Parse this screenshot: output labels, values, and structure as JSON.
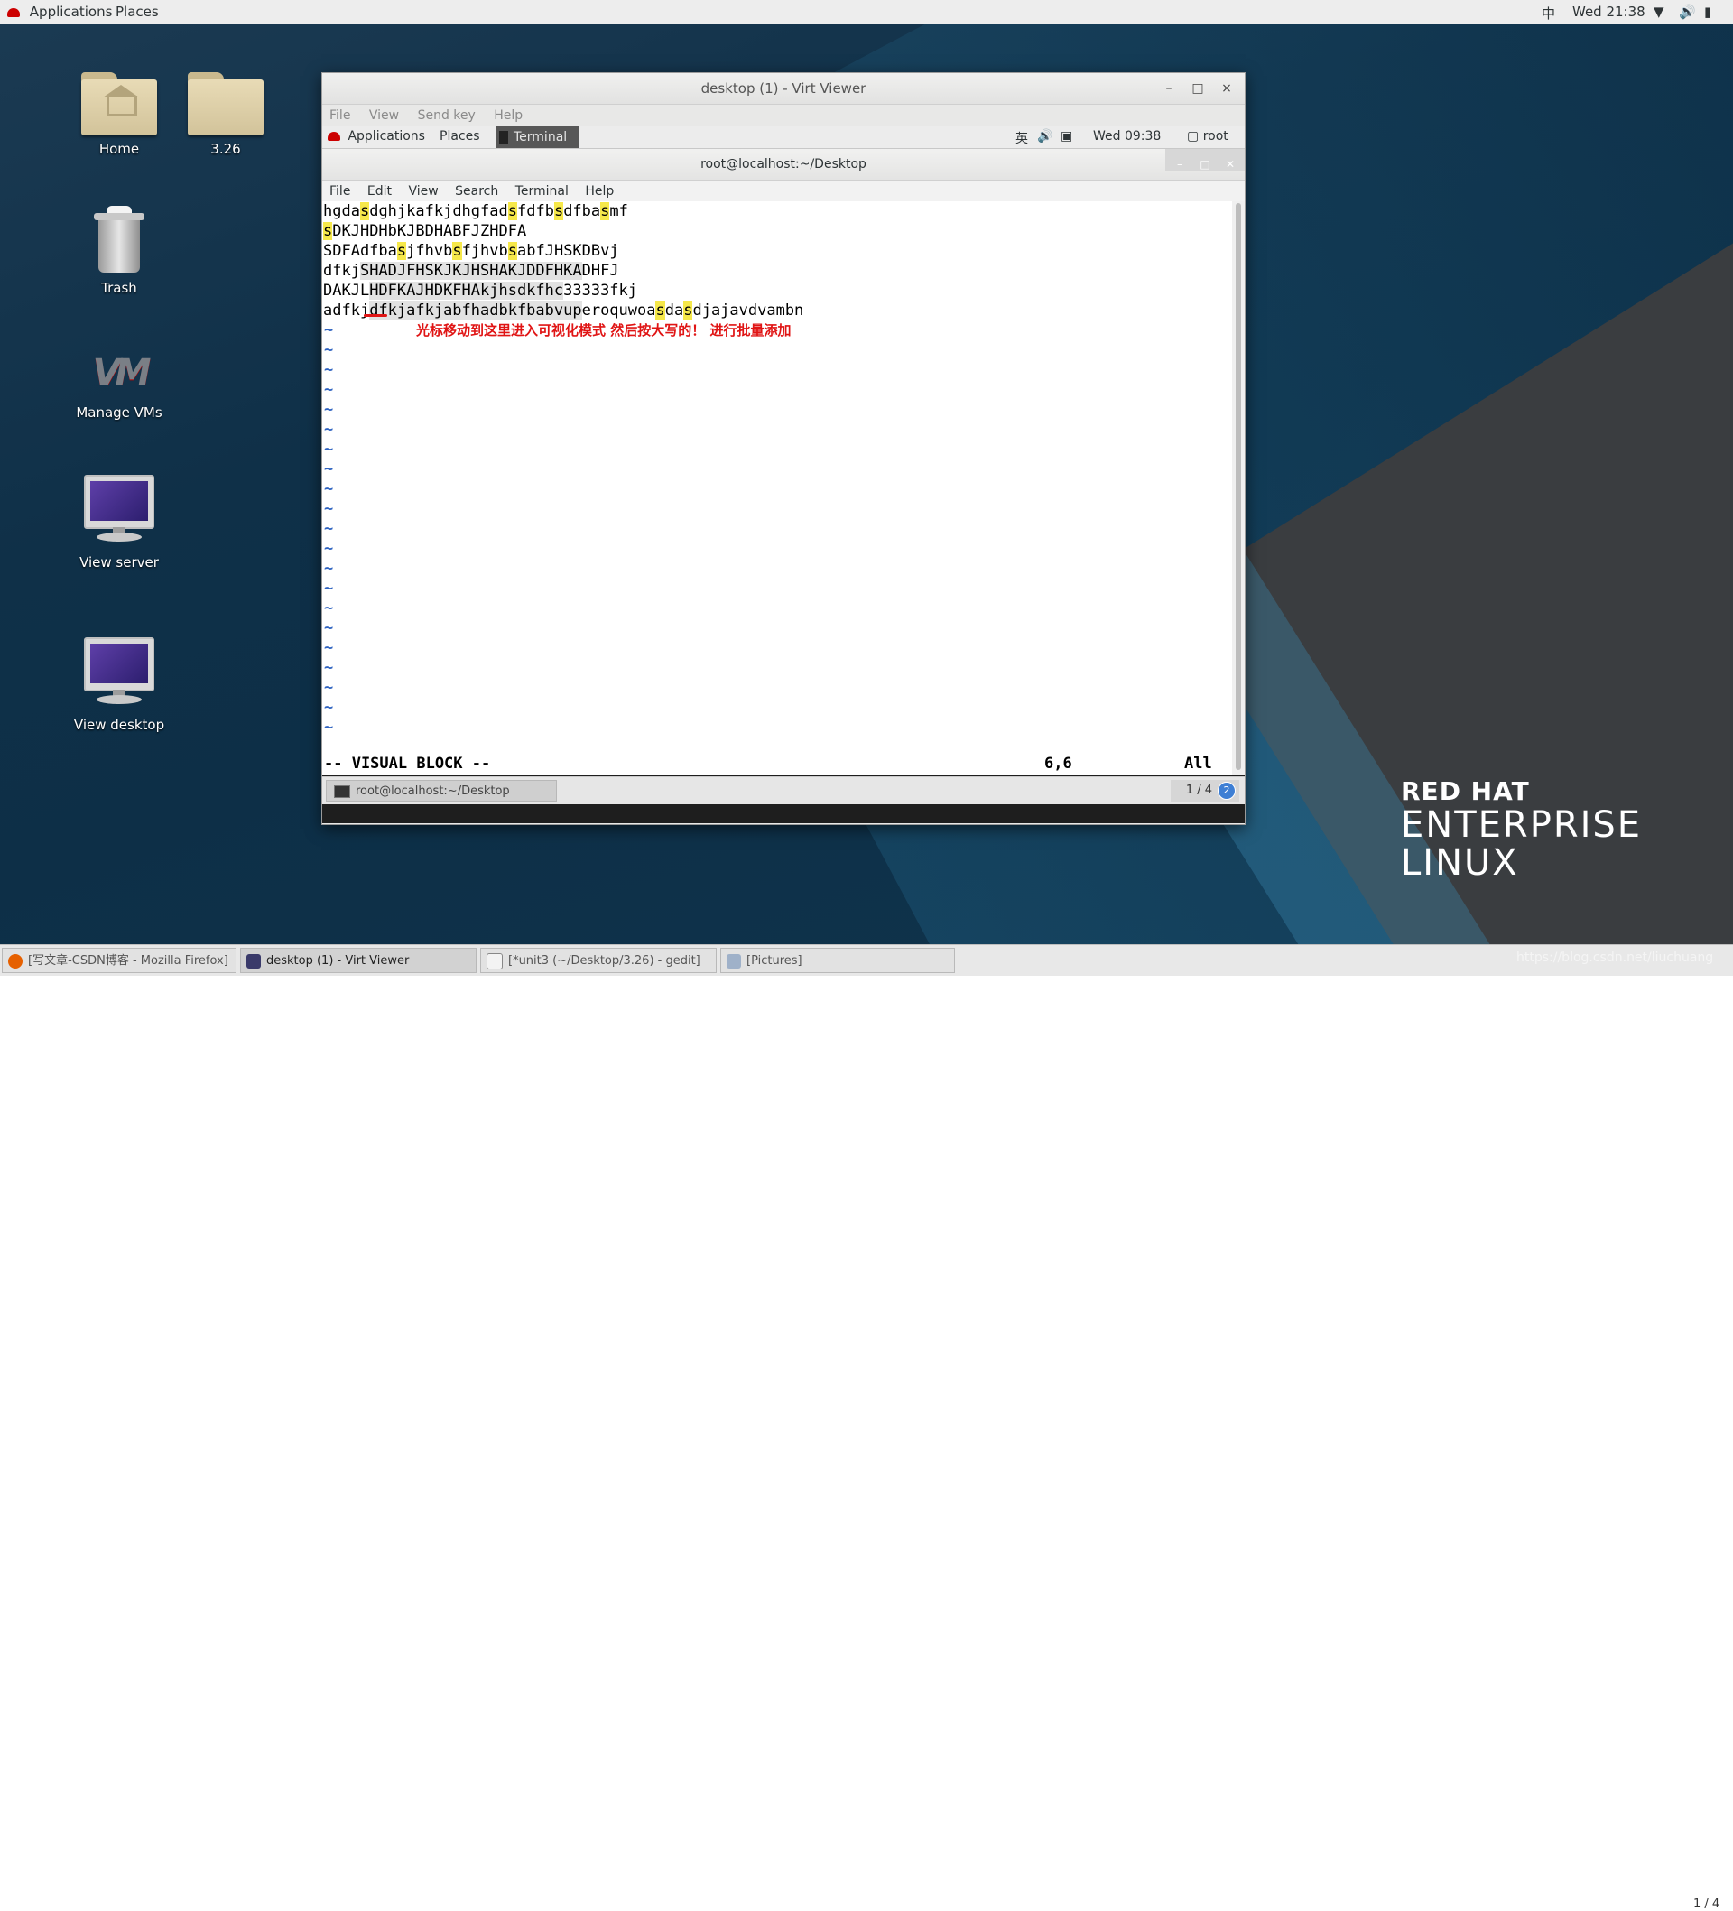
{
  "topbar": {
    "applications": "Applications",
    "places": "Places",
    "input_method": "中",
    "clock": "Wed 21:38"
  },
  "desktop_icons": {
    "home": "Home",
    "folder": "3.26",
    "trash": "Trash",
    "manage_vms": "Manage VMs",
    "view_server": "View server",
    "view_desktop": "View desktop",
    "vm_logo_text": "VM"
  },
  "virt_viewer": {
    "title": "desktop (1) - Virt Viewer",
    "menu": [
      "File",
      "View",
      "Send key",
      "Help"
    ],
    "buttons": {
      "minimize": "–",
      "maximize": "□",
      "close": "×"
    }
  },
  "guest_topbar": {
    "applications": "Applications",
    "places": "Places",
    "terminal_tab": "Terminal",
    "input_method": "英",
    "clock": "Wed 09:38",
    "user": "root"
  },
  "terminal": {
    "title": "root@localhost:~/Desktop",
    "menu": [
      "File",
      "Edit",
      "View",
      "Search",
      "Terminal",
      "Help"
    ],
    "tilde": "~",
    "note": "光标移动到这里进入可视化模式  然后按大写的！ 进行批量添加",
    "status_mode": "-- VISUAL BLOCK --",
    "status_pos": "6,6",
    "status_all": "All"
  },
  "lines": [
    [
      [
        "hgda",
        ""
      ],
      [
        "s",
        "hl"
      ],
      [
        "dghjkafkjdhgfad",
        ""
      ],
      [
        "s",
        "hl"
      ],
      [
        "fdfb",
        ""
      ],
      [
        "s",
        "hl"
      ],
      [
        "dfba",
        ""
      ],
      [
        "s",
        "hl"
      ],
      [
        "mf",
        ""
      ]
    ],
    [
      [
        "s",
        "hl"
      ],
      [
        "DKJHDHbKJBDHABFJZHDFA",
        ""
      ]
    ],
    [
      [
        "SDFAdfba",
        ""
      ],
      [
        "s",
        "hl"
      ],
      [
        "jfhvb",
        ""
      ],
      [
        "s",
        "hl"
      ],
      [
        "fjhvb",
        ""
      ],
      [
        "s",
        "hl"
      ],
      [
        "abfJHSKDBvj",
        ""
      ]
    ],
    [
      [
        "dfkj",
        ""
      ],
      [
        "SHADJFHSKJKJHSHAKJDDFHKA",
        "sel"
      ],
      [
        "DHFJ",
        ""
      ]
    ],
    [
      [
        "DAKJL",
        ""
      ],
      [
        "HDFKAJHDKFHAkjhsdkfhc",
        "sel"
      ],
      [
        "33333fkj",
        ""
      ]
    ],
    [
      [
        "adfkj",
        ""
      ],
      [
        "dfkjafkjabfhadbkfbabvup",
        "sel"
      ],
      [
        "eroquwoa",
        ""
      ],
      [
        "s",
        "hl"
      ],
      [
        "da",
        ""
      ],
      [
        "s",
        "hl"
      ],
      [
        "djajavdvambn",
        ""
      ]
    ]
  ],
  "guest_bottom": {
    "task": "root@localhost:~/Desktop",
    "workspace": "1 / 4",
    "badge": "2"
  },
  "taskbar": {
    "items": [
      "[写文章-CSDN博客 - Mozilla Firefox]",
      "desktop (1) - Virt Viewer",
      "[*unit3 (~/Desktop/3.26) - gedit]",
      "[Pictures]"
    ],
    "pager": "1 / 4",
    "watermark": "https://blog.csdn.net/liuchuang"
  },
  "brand": {
    "line1": "RED HAT",
    "line2": "ENTERPRISE",
    "line3": "LINUX"
  },
  "colors": {
    "highlight": "#f6e84a",
    "annotation": "#e01414",
    "tilde": "#2f63c0"
  }
}
